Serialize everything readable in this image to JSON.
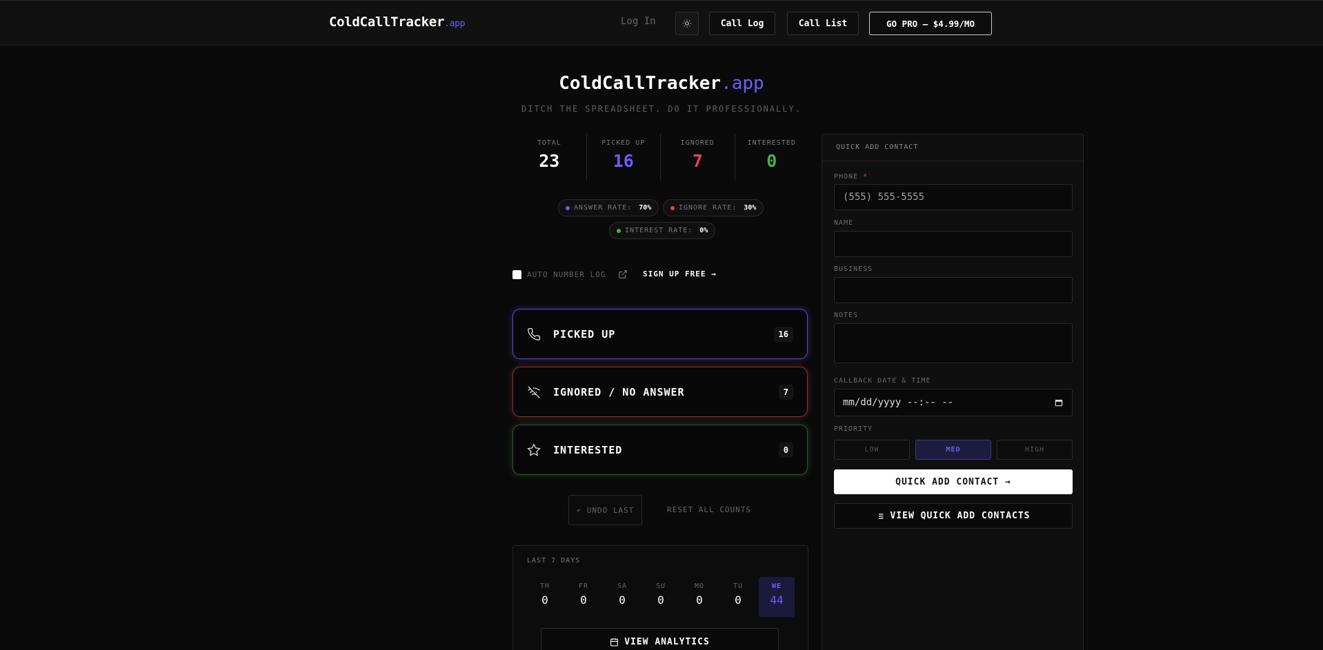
{
  "nav": {
    "brand": "ColdCallTracker",
    "brand_accent": ".app",
    "login": "Log In",
    "call_log": "Call Log",
    "call_list": "Call List",
    "go_pro": "GO PRO — $4.99/MO"
  },
  "hero": {
    "title": "ColdCallTracker",
    "title_accent": ".app",
    "tagline": "DITCH THE SPREADSHEET. DO IT PROFESSIONALLY."
  },
  "stats": {
    "total_label": "TOTAL",
    "total": "23",
    "picked_label": "PICKED UP",
    "picked": "16",
    "ignored_label": "IGNORED",
    "ignored": "7",
    "interested_label": "INTERESTED",
    "interested": "0"
  },
  "rates": {
    "answer_label": "ANSWER RATE:",
    "answer": "70%",
    "ignore_label": "IGNORE RATE:",
    "ignore": "30%",
    "interest_label": "INTEREST RATE:",
    "interest": "0%"
  },
  "options": {
    "auto_number_log": "AUTO NUMBER LOG",
    "sign_up": "SIGN UP FREE →"
  },
  "actions": {
    "picked_up": "PICKED UP",
    "picked_up_count": "16",
    "ignored": "IGNORED / NO ANSWER",
    "ignored_count": "7",
    "interested": "INTERESTED",
    "interested_count": "0"
  },
  "controls": {
    "undo": "↶ UNDO LAST",
    "reset": "RESET ALL COUNTS"
  },
  "week": {
    "title": "LAST 7 DAYS",
    "days": [
      {
        "label": "TH",
        "value": "0"
      },
      {
        "label": "FR",
        "value": "0"
      },
      {
        "label": "SA",
        "value": "0"
      },
      {
        "label": "SU",
        "value": "0"
      },
      {
        "label": "MO",
        "value": "0"
      },
      {
        "label": "TU",
        "value": "0"
      },
      {
        "label": "WE",
        "value": "44"
      }
    ],
    "analytics": "VIEW ANALYTICS"
  },
  "quick_add": {
    "title": "QUICK ADD CONTACT",
    "phone_label": "PHONE",
    "phone_required": "*",
    "phone_placeholder": "(555) 555-5555",
    "name_label": "NAME",
    "business_label": "BUSINESS",
    "notes_label": "NOTES",
    "callback_label": "CALLBACK DATE & TIME",
    "callback_placeholder": "mm/dd/yyyy --:-- --",
    "priority_label": "PRIORITY",
    "priority_low": "LOW",
    "priority_med": "MED",
    "priority_high": "HIGH",
    "submit": "QUICK ADD CONTACT →",
    "view": "VIEW QUICK ADD CONTACTS"
  },
  "colors": {
    "accent": "#6e5ef5",
    "red": "#e0484a",
    "green": "#4caf50",
    "background": "#0a0a0a"
  }
}
